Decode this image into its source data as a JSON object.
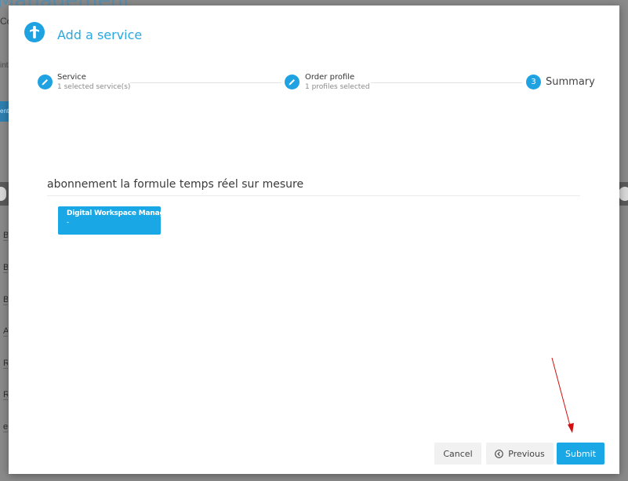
{
  "background": {
    "title_fragment": "Management",
    "small_text": "Co",
    "small_text_2": "int",
    "button_fragment": "ents",
    "row_letters": [
      "B",
      "B",
      "B",
      "A",
      "R",
      "R",
      "el"
    ]
  },
  "modal": {
    "title": "Add a service",
    "header_icon": "service-logo-icon"
  },
  "stepper": {
    "steps": [
      {
        "label": "Service",
        "sub": "1 selected service(s)",
        "state": "completed",
        "icon": "pencil-icon"
      },
      {
        "label": "Order profile",
        "sub": "1 profiles selected",
        "state": "completed",
        "icon": "pencil-icon"
      },
      {
        "number": "3",
        "label": "Summary",
        "state": "active"
      }
    ]
  },
  "summary": {
    "offer_title": "abonnement la formule temps réel sur mesure",
    "services": [
      {
        "name": "Digital Workspace Manager",
        "detail": "-"
      }
    ]
  },
  "footer": {
    "cancel_label": "Cancel",
    "previous_label": "Previous",
    "submit_label": "Submit"
  },
  "colors": {
    "accent": "#19a7e6",
    "annotation_arrow": "#d01010"
  }
}
